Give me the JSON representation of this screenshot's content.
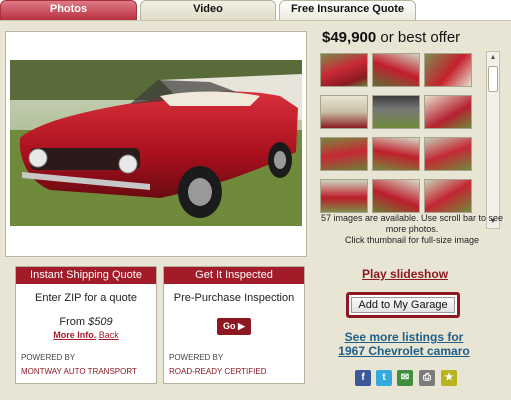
{
  "tabs": [
    {
      "label": "Photos"
    },
    {
      "label": "Video"
    },
    {
      "label": "Free Insurance Quote"
    }
  ],
  "listing": {
    "price": "$49,900",
    "price_suffix": " or best offer"
  },
  "photos": {
    "count_note": "57 images are available. Use scroll bar to see more photos.",
    "click_note": "Click thumbnail for full-size image"
  },
  "shipping": {
    "header": "Instant Shipping Quote",
    "line1": "Enter ZIP for a quote",
    "from_label": "From ",
    "from_price": "$509",
    "more_info": "More Info.",
    "back": "Back",
    "powered_by": "POWERED BY",
    "brand": "MONTWAY AUTO TRANSPORT"
  },
  "inspection": {
    "header": "Get It Inspected",
    "line1": "Pre-Purchase Inspection",
    "go_label": "Go ▶",
    "powered_by": "POWERED BY",
    "brand": "ROAD-READY CERTIFIED"
  },
  "actions": {
    "slideshow": "Play slideshow",
    "garage": "Add to My Garage",
    "see_more_line1": "See more listings for",
    "see_more_line2": "1967 Chevrolet camaro"
  },
  "share_icons": [
    {
      "icon": "facebook-icon",
      "glyph": "f",
      "color": "#3b5998"
    },
    {
      "icon": "twitter-icon",
      "glyph": "t",
      "color": "#33a9df"
    },
    {
      "icon": "email-icon",
      "glyph": "✉",
      "color": "#3f8f3f"
    },
    {
      "icon": "print-icon",
      "glyph": "⎙",
      "color": "#7c7c7c"
    },
    {
      "icon": "bookmark-icon",
      "glyph": "★",
      "color": "#b7b420"
    }
  ]
}
